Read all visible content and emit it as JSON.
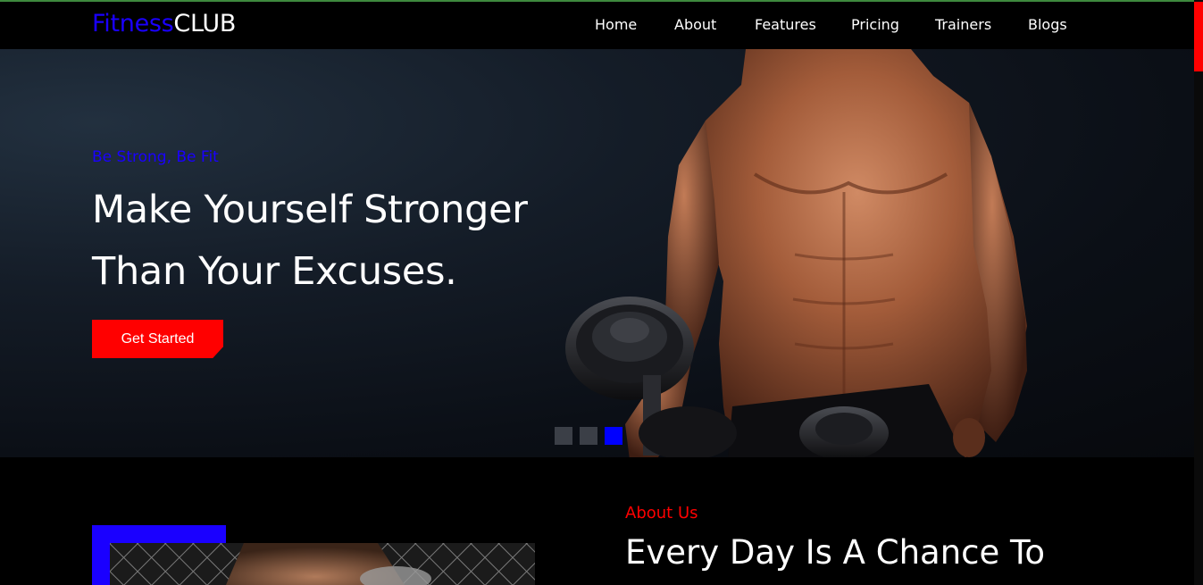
{
  "navbar": {
    "logo_part1": "Fitness",
    "logo_part2": "CLUB",
    "links": [
      "Home",
      "About",
      "Features",
      "Pricing",
      "Trainers",
      "Blogs"
    ]
  },
  "hero": {
    "tagline": "Be Strong, Be Fit",
    "headline_line1": "Make Yourself Stronger",
    "headline_line2": "Than Your Excuses.",
    "cta_label": "Get Started",
    "slides_total": 3,
    "active_slide": 3
  },
  "about": {
    "label": "About Us",
    "heading": "Every Day Is A Chance To"
  },
  "colors": {
    "brand_blue": "#1a00ff",
    "accent_red": "#ff0000",
    "active_dot": "#0000ff",
    "background": "#000000"
  },
  "icons": {
    "hero_image": "muscular-man-with-dumbbell",
    "about_image": "man-with-chain-fence"
  }
}
